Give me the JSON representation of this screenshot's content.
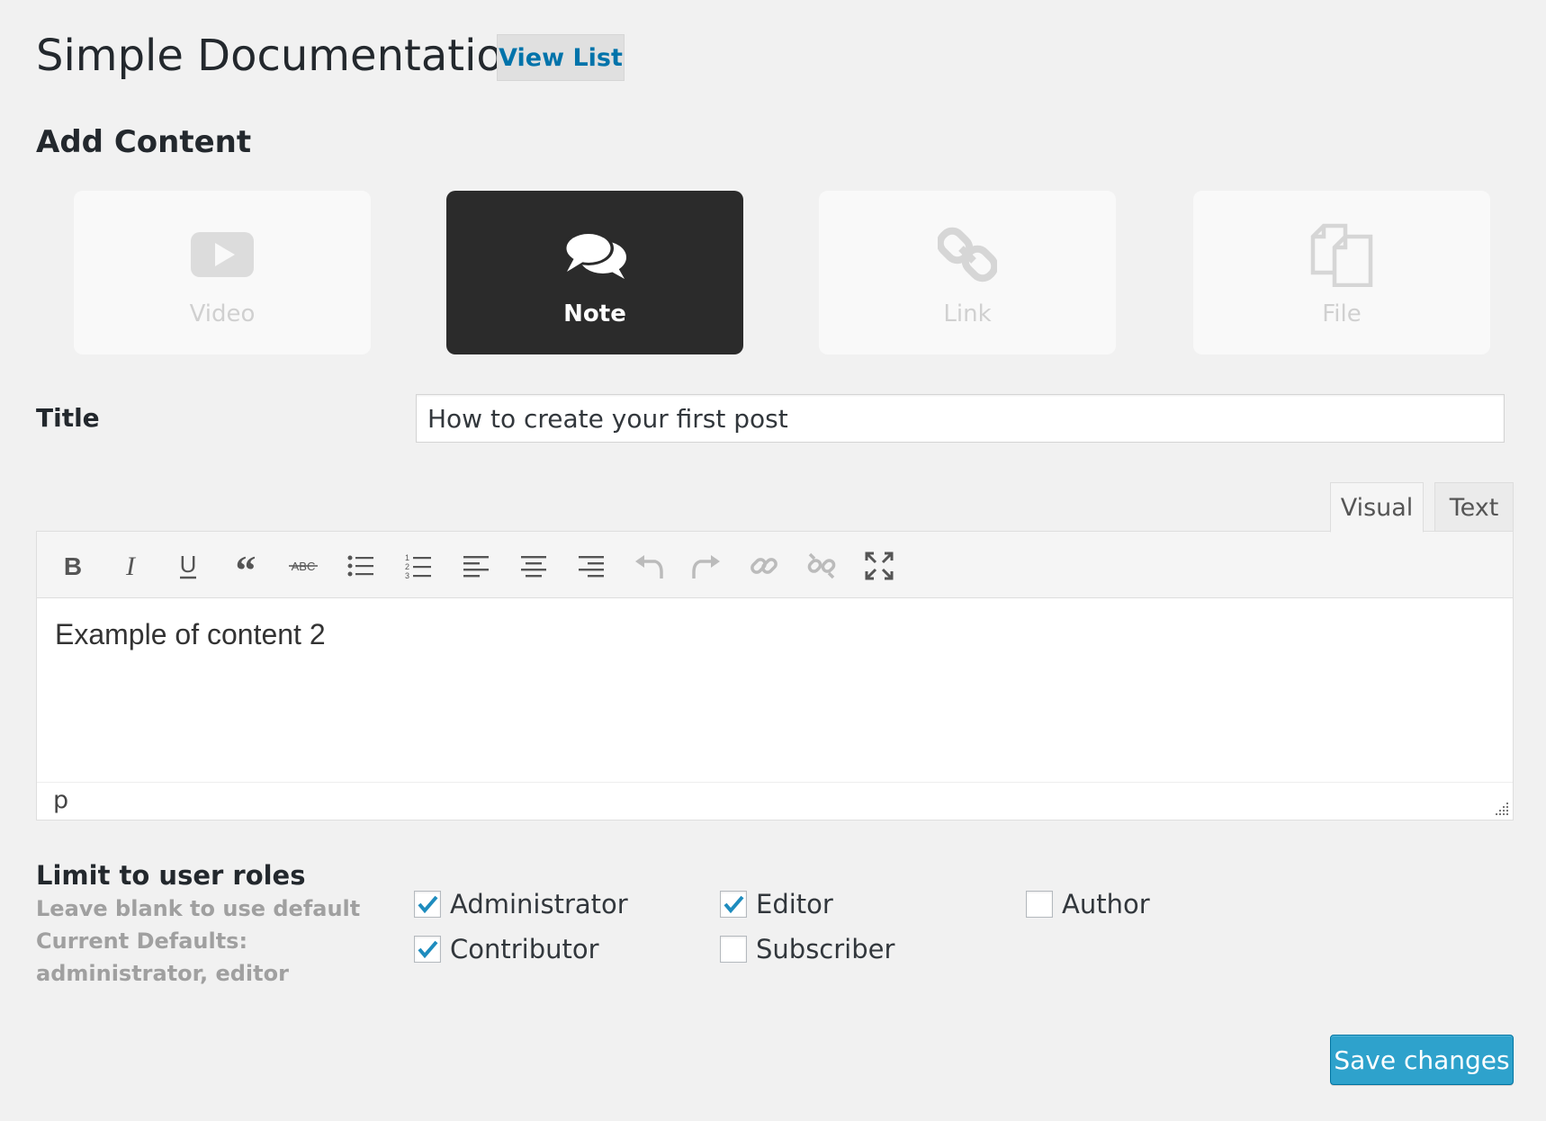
{
  "header": {
    "title": "Simple Documentation",
    "view_list_label": "View List"
  },
  "add_content": {
    "heading": "Add Content",
    "types": [
      {
        "label": "Video",
        "icon": "video-icon",
        "active": false
      },
      {
        "label": "Note",
        "icon": "note-icon",
        "active": true
      },
      {
        "label": "Link",
        "icon": "link-icon",
        "active": false
      },
      {
        "label": "File",
        "icon": "file-icon",
        "active": false
      }
    ]
  },
  "title_field": {
    "label": "Title",
    "value": "How to create your first post"
  },
  "editor": {
    "tabs": {
      "visual": "Visual",
      "text": "Text",
      "active": "visual"
    },
    "toolbar": [
      "bold-icon",
      "italic-icon",
      "underline-icon",
      "blockquote-icon",
      "strikethrough-icon",
      "bullet-list-icon",
      "numbered-list-icon",
      "align-left-icon",
      "align-center-icon",
      "align-right-icon",
      "undo-icon",
      "redo-icon",
      "insert-link-icon",
      "remove-link-icon",
      "fullscreen-icon"
    ],
    "content": "Example of content 2",
    "path": "p"
  },
  "roles": {
    "heading": "Limit to user roles",
    "help_line1": "Leave blank to use default",
    "help_line2": "Current Defaults:",
    "help_line3": "administrator, editor",
    "options": [
      {
        "label": "Administrator",
        "checked": true
      },
      {
        "label": "Editor",
        "checked": true
      },
      {
        "label": "Author",
        "checked": false
      },
      {
        "label": "Contributor",
        "checked": true
      },
      {
        "label": "Subscriber",
        "checked": false
      }
    ]
  },
  "save_label": "Save changes",
  "colors": {
    "accent": "#0073aa",
    "primary_button": "#2ea2cc",
    "active_card": "#2b2b2b",
    "check": "#1e8cbe"
  }
}
